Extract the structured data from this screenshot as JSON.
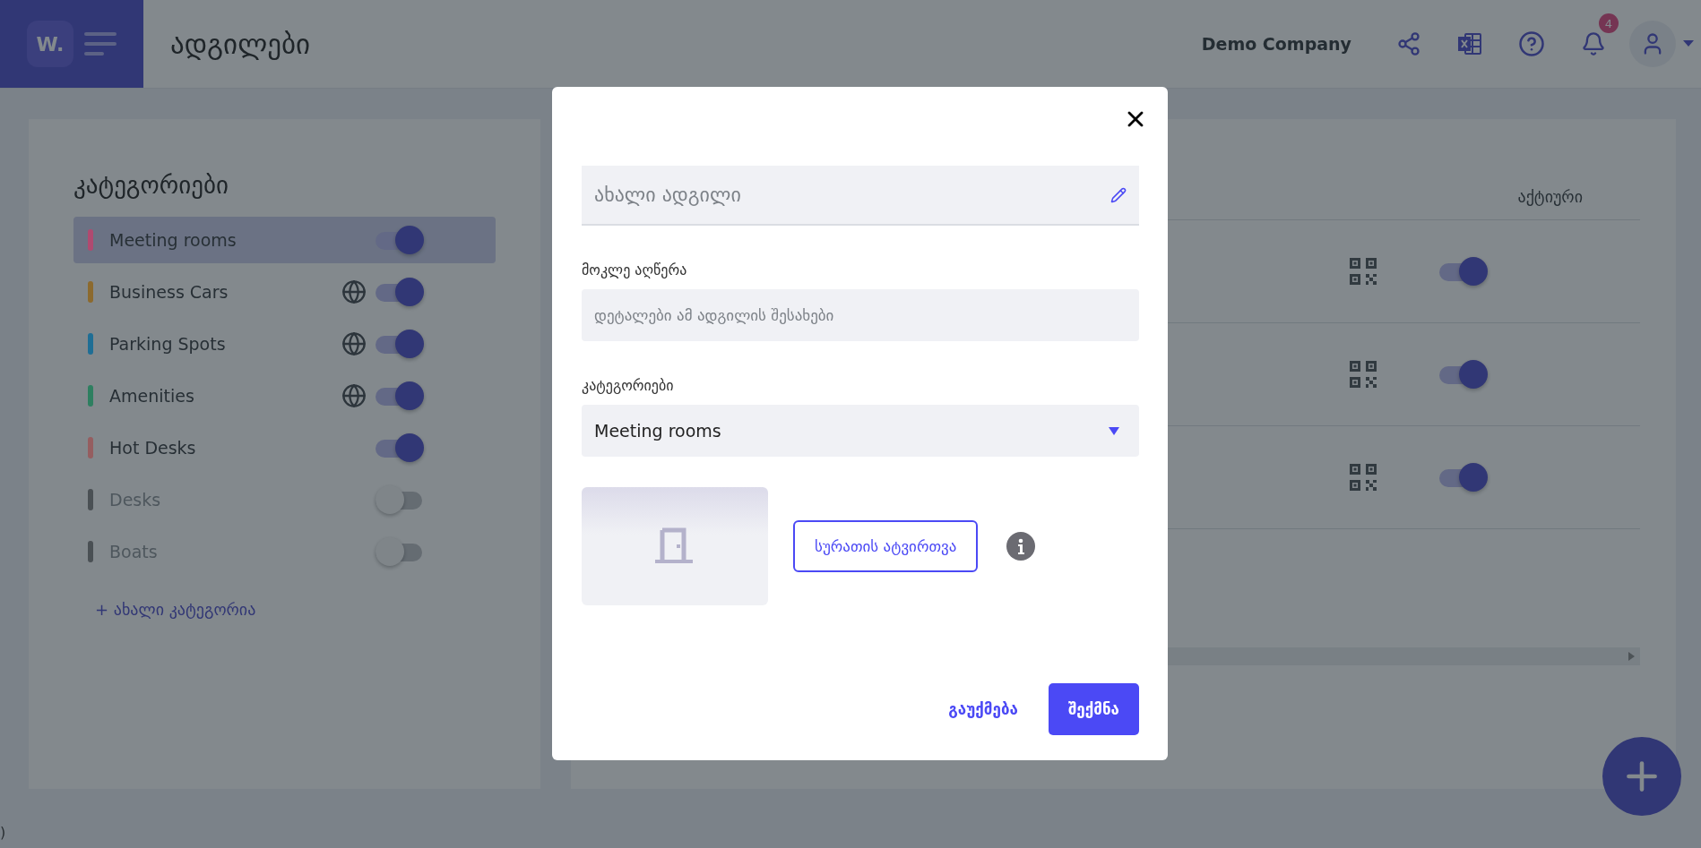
{
  "header": {
    "logo_text": "W.",
    "title": "ადგილები",
    "company": "Demo Company",
    "notification_count": "4"
  },
  "categories": {
    "title": "კატეგორიები",
    "items": [
      {
        "name": "Meeting rooms",
        "color": "#b04a70",
        "public": false,
        "enabled": true,
        "selected": true
      },
      {
        "name": "Business Cars",
        "color": "#8c6a2e",
        "public": true,
        "enabled": true,
        "selected": false
      },
      {
        "name": "Parking Spots",
        "color": "#1f6e95",
        "public": true,
        "enabled": true,
        "selected": false
      },
      {
        "name": "Amenities",
        "color": "#2e7f60",
        "public": true,
        "enabled": true,
        "selected": false
      },
      {
        "name": "Hot Desks",
        "color": "#955e60",
        "public": false,
        "enabled": true,
        "selected": false
      },
      {
        "name": "Desks",
        "color": "#4a5054",
        "public": false,
        "enabled": false,
        "selected": false
      },
      {
        "name": "Boats",
        "color": "#4a5054",
        "public": false,
        "enabled": false,
        "selected": false
      }
    ],
    "add_link": "+ ახალი კატეგორია"
  },
  "table": {
    "columns": [
      "აქტიური"
    ],
    "rows": [
      {
        "active": true
      },
      {
        "active": true
      },
      {
        "active": true
      }
    ]
  },
  "edge_fragment": ")",
  "modal": {
    "name_placeholder": "ახალი ადგილი",
    "description_label": "მოკლე აღწერა",
    "description_placeholder": "დეტალები ამ ადგილის შესახები",
    "category_label": "კატეგორიები",
    "category_value": "Meeting rooms",
    "upload_button": "სურათის ატვირთვა",
    "cancel_button": "გაუქმება",
    "create_button": "შექმნა"
  }
}
